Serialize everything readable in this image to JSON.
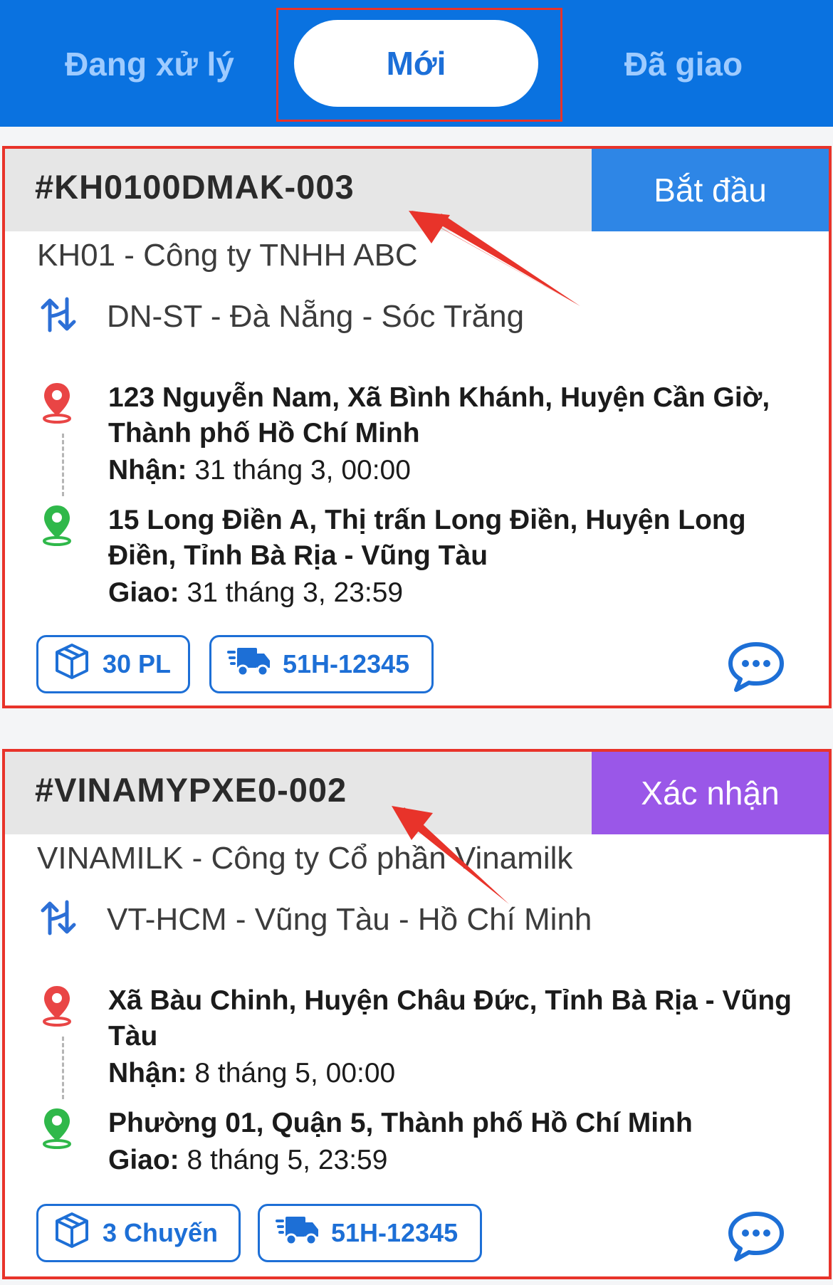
{
  "tabs": {
    "processing": "Đang xử lý",
    "new": "Mới",
    "delivered": "Đã giao"
  },
  "orders": [
    {
      "code": "#KH0100DMAK-003",
      "action": "Bắt đầu",
      "action_color": "#2e86e6",
      "customer": "KH01 - Công ty TNHH ABC",
      "route": "DN-ST - Đà Nẵng - Sóc Trăng",
      "pickup_address": "123 Nguyễn Nam, Xã Bình Khánh, Huyện Cần Giờ, Thành phố Hồ Chí Minh",
      "pickup_label": "Nhận:",
      "pickup_time": " 31 tháng 3, 00:00",
      "dropoff_address": "15 Long Điền A, Thị trấn Long Điền, Huyện Long Điền, Tỉnh Bà Rịa - Vũng Tàu",
      "dropoff_label": "Giao:",
      "dropoff_time": " 31 tháng 3, 23:59",
      "quantity": "30 PL",
      "vehicle": "51H-12345"
    },
    {
      "code": "#VINAMYPXE0-002",
      "action": "Xác nhận",
      "action_color": "#9a57e8",
      "customer": "VINAMILK - Công ty Cổ phần Vinamilk",
      "route": "VT-HCM - Vũng Tàu - Hồ Chí Minh",
      "pickup_address": "Xã Bàu Chinh, Huyện Châu Đức, Tỉnh Bà Rịa - Vũng Tàu",
      "pickup_label": "Nhận:",
      "pickup_time": " 8 tháng 5, 00:00",
      "dropoff_address": "Phường 01, Quận 5, Thành phố Hồ Chí Minh",
      "dropoff_label": "Giao:",
      "dropoff_time": " 8 tháng 5, 23:59",
      "quantity": "3 Chuyến",
      "vehicle": "51H-12345"
    }
  ],
  "icons": {
    "route": "route-swap-icon",
    "pickup": "red-map-pin-icon",
    "dropoff": "green-map-pin-icon",
    "quantity": "package-box-icon",
    "vehicle": "delivery-truck-icon",
    "chat": "chat-bubble-icon"
  },
  "colors": {
    "primary": "#0a72e0",
    "annotation": "#e8332a",
    "pickup_pin": "#e94545",
    "dropoff_pin": "#2fb84a"
  }
}
